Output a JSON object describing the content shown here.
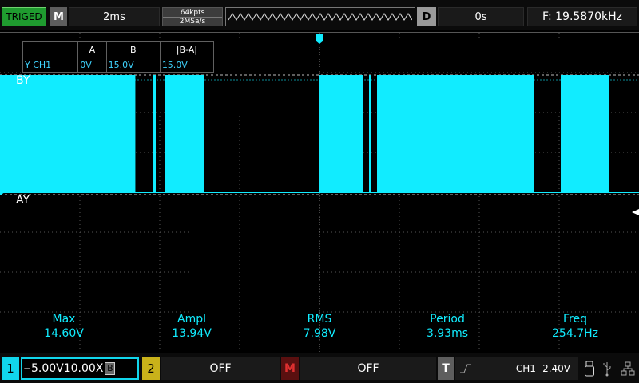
{
  "topbar": {
    "trigger_status": "TRIGED",
    "mode": "M",
    "timebase": "2ms",
    "memory_depth": "64kpts",
    "sample_rate": "2MSa/s",
    "delay_button": "D",
    "delay_value": "0s",
    "frequency": "F: 19.5870kHz"
  },
  "cursor": {
    "header": [
      "",
      "A",
      "B",
      "|B-A|"
    ],
    "row_label": "Y CH1",
    "a": "0V",
    "b": "15.0V",
    "delta": "15.0V",
    "label_b": "BY",
    "label_a": "AY"
  },
  "measurements": [
    {
      "name": "Max",
      "value": "14.60V"
    },
    {
      "name": "Ampl",
      "value": "13.94V"
    },
    {
      "name": "RMS",
      "value": "7.98V"
    },
    {
      "name": "Period",
      "value": "3.93ms"
    },
    {
      "name": "Freq",
      "value": "254.7Hz"
    }
  ],
  "bottombar": {
    "ch1_number": "1",
    "ch1_scale": "5.00V",
    "ch1_probe": "10.00X",
    "ch1_bw": "B",
    "ch2_number": "2",
    "ch2_state": "OFF",
    "math_button": "M",
    "math_state": "OFF",
    "trigger_button": "T",
    "trigger_info": "CH1 -2.40V"
  },
  "colors": {
    "ch1": "#11ecff",
    "ch2": "#c9b21a",
    "triged": "#1f9b2f"
  },
  "waveform": {
    "segments": [
      [
        0,
        0.2118
      ],
      [
        0.2575,
        0.32
      ],
      [
        0.5,
        0.5675
      ],
      [
        0.59,
        0.835
      ],
      [
        0.8775,
        0.9525
      ]
    ],
    "spikes": [
      0.24,
      0.5775
    ]
  }
}
